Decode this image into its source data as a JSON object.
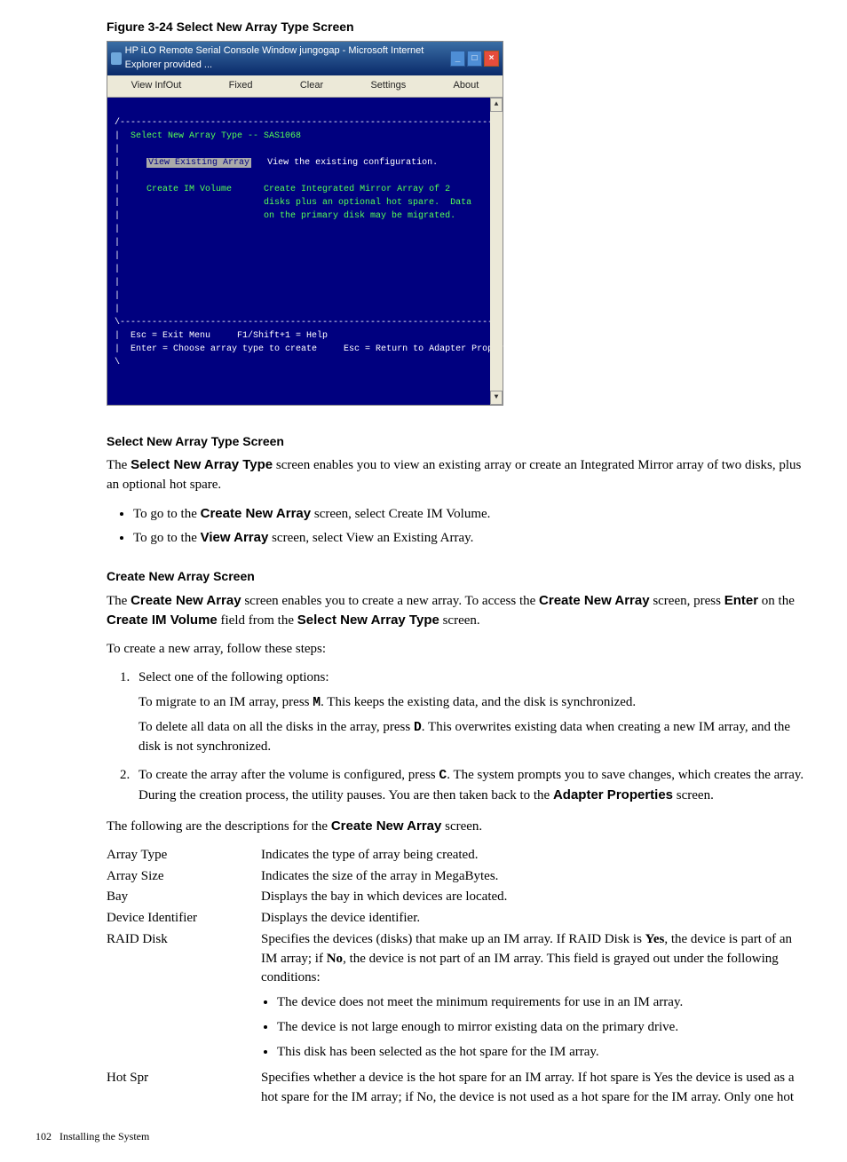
{
  "figure": {
    "caption": "Figure 3-24 Select New Array Type Screen",
    "titlebar": "HP iLO Remote Serial Console Window jungogap - Microsoft Internet Explorer provided ...",
    "menu": {
      "m1": "View InfOut",
      "m2": "Fixed",
      "m3": "Clear",
      "m4": "Settings",
      "m5": "About"
    },
    "term": {
      "heading": "Select New Array Type -- SAS1068",
      "opt1": "View Existing Array",
      "opt1desc": "View the existing configuration.",
      "opt2": "Create IM Volume",
      "opt2desc1": "Create Integrated Mirror Array of 2",
      "opt2desc2": "disks plus an optional hot spare.  Data",
      "opt2desc3": "on the primary disk may be migrated.",
      "foot1": "Esc = Exit Menu     F1/Shift+1 = Help",
      "foot2": "Enter = Choose array type to create     Esc = Return to Adapter Properties"
    }
  },
  "s1": {
    "heading": "Select New Array Type Screen",
    "p1a": "The ",
    "p1b": "Select New Array Type",
    "p1c": " screen enables you to view an existing array or create an Integrated Mirror array of two disks, plus an optional hot spare.",
    "li1a": "To go to the ",
    "li1b": "Create New Array",
    "li1c": " screen, select Create IM Volume.",
    "li2a": "To go to the ",
    "li2b": "View Array",
    "li2c": " screen, select View an Existing Array."
  },
  "s2": {
    "heading": "Create New Array Screen",
    "p1a": "The ",
    "p1b": "Create New Array",
    "p1c": " screen enables you to create a new array. To access the ",
    "p1d": "Create New Array",
    "p1e": " screen, press ",
    "p1f": "Enter",
    "p1g": " on the ",
    "p1h": "Create IM Volume",
    "p1i": " field from the ",
    "p1j": "Select New Array Type",
    "p1k": " screen.",
    "p2": "To create a new array, follow these steps:",
    "step1_intro": "Select one of the following options:",
    "step1_pa1": "To migrate to an IM array, press ",
    "step1_pakey": "M",
    "step1_pa2": ". This keeps the existing data, and the disk is synchronized.",
    "step1_pb1": "To delete all data on all the disks in the array, press ",
    "step1_pbkey": "D",
    "step1_pb2": ". This overwrites existing data when creating a new IM array, and the disk is not synchronized.",
    "step2_a": "To create the array after the volume is configured, press ",
    "step2_key": "C",
    "step2_b": ". The system prompts you to save changes, which creates the array. During the creation process, the utility pauses. You are then taken back to the ",
    "step2_c": "Adapter Properties",
    "step2_d": " screen.",
    "p3a": "The following are the descriptions for the ",
    "p3b": "Create New Array",
    "p3c": " screen."
  },
  "dl": {
    "t1": "Array Type",
    "d1": "Indicates the type of array being created.",
    "t2": "Array Size",
    "d2": "Indicates the size of the array in MegaBytes.",
    "t3": "Bay",
    "d3": "Displays the bay in which devices are located.",
    "t4": "Device Identifier",
    "d4": "Displays the device identifier.",
    "t5": "RAID Disk",
    "d5a": "Specifies the devices (disks) that make up an IM array. If RAID Disk is ",
    "d5yes": "Yes",
    "d5b": ", the device is part of an IM array; if ",
    "d5no": "No",
    "d5c": ", the device is not part of an IM array. This field is grayed out under the following conditions:",
    "d5li1": "The device does not meet the minimum requirements for use in an IM array.",
    "d5li2": "The device is not large enough to mirror existing data on the primary drive.",
    "d5li3": "This disk has been selected as the hot spare for the IM array.",
    "t6": "Hot Spr",
    "d6": "Specifies whether a device is the hot spare for an IM array. If hot spare is Yes the device is used as a hot spare for the IM array; if No, the device is not used as a hot spare for the IM array. Only one hot"
  },
  "footer": {
    "page": "102",
    "section": "Installing the System"
  }
}
